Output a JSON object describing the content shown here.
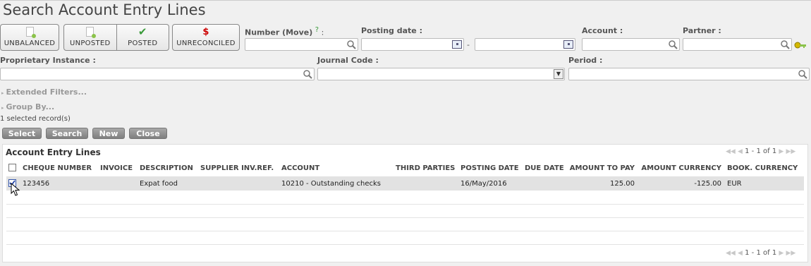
{
  "title": "Search Account Entry Lines",
  "filters": {
    "unbalanced": "UNBALANCED",
    "unposted": "UNPOSTED",
    "posted": "POSTED",
    "unreconciled": "UNRECONCILED"
  },
  "fields": {
    "number_move": {
      "label": "Number (Move)",
      "help": "?",
      "colon": ":",
      "value": ""
    },
    "posting_date": {
      "label": "Posting date :",
      "from": "",
      "to": "",
      "separator": "-"
    },
    "account": {
      "label": "Account :",
      "value": ""
    },
    "partner": {
      "label": "Partner :",
      "value": ""
    },
    "proprietary_instance": {
      "label": "Proprietary Instance :",
      "value": ""
    },
    "journal_code": {
      "label": "Journal Code :",
      "value": ""
    },
    "period": {
      "label": "Period :",
      "value": ""
    }
  },
  "extended_filters": "Extended Filters...",
  "group_by": "Group By...",
  "selected_records": "1 selected record(s)",
  "actions": {
    "select": "Select",
    "search": "Search",
    "new": "New",
    "close": "Close"
  },
  "list": {
    "title": "Account Entry Lines",
    "pager": "1 - 1 of 1",
    "columns": [
      "CHEQUE NUMBER",
      "INVOICE",
      "DESCRIPTION",
      "SUPPLIER INV.REF.",
      "ACCOUNT",
      "THIRD PARTIES",
      "POSTING DATE",
      "DUE DATE",
      "AMOUNT TO PAY",
      "AMOUNT CURRENCY",
      "BOOK. CURRENCY"
    ],
    "rows": [
      {
        "selected": true,
        "cheque_number": "123456",
        "invoice": "",
        "description": "Expat food",
        "supplier_inv_ref": "",
        "account": "10210 - Outstanding checks",
        "third_parties": "",
        "posting_date": "16/May/2016",
        "due_date": "",
        "amount_to_pay": "125.00",
        "amount_currency": "-125.00",
        "book_currency": "EUR"
      }
    ]
  }
}
